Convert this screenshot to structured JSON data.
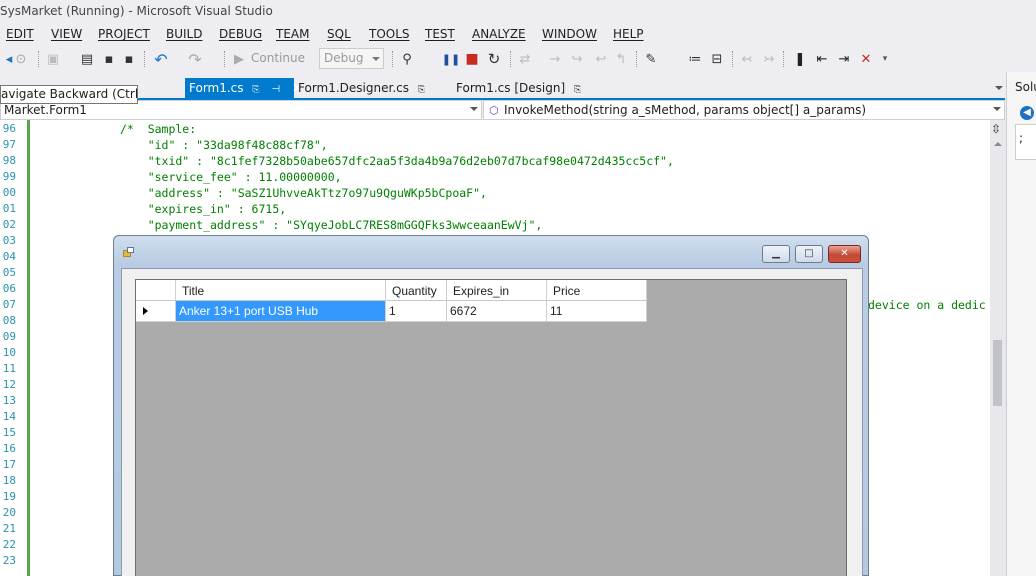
{
  "window": {
    "title": "SysMarket (Running) - Microsoft Visual Studio"
  },
  "menu": [
    "EDIT",
    "VIEW",
    "PROJECT",
    "BUILD",
    "DEBUG",
    "TEAM",
    "SQL",
    "TOOLS",
    "TEST",
    "ANALYZE",
    "WINDOW",
    "HELP"
  ],
  "toolbar": {
    "continue_label": "Continue",
    "config_value": "Debug"
  },
  "tooltip": "avigate Backward (Ctrl+-)",
  "tabs": [
    "Form1.cs",
    "Form1.Designer.cs",
    "Form1.cs [Design]"
  ],
  "nav": {
    "left": "Market.Form1",
    "right": "InvokeMethod(string a_sMethod, params object[] a_params)"
  },
  "editor": {
    "line_numbers": [
      "96",
      "97",
      "98",
      "99",
      "00",
      "01",
      "02",
      "03",
      "04",
      "05",
      "06",
      "07",
      "08",
      "09",
      "10",
      "11",
      "12",
      "13",
      "14",
      "15",
      "16",
      "17",
      "18",
      "19",
      "20",
      "21",
      "22",
      "23"
    ],
    "code": [
      "/*  Sample:",
      "    \"id\" : \"33da98f48c88cf78\",",
      "    \"txid\" : \"8c1fef7328b50abe657dfc2aa5f3da4b9a76d2eb07d7bcaf98e0472d435cc5cf\",",
      "    \"service_fee\" : 11.00000000,",
      "    \"address\" : \"SaSZ1UhvveAkTtz7o97u9QguWKp5bCpoaF\",",
      "    \"expires_in\" : 6715,",
      "    \"payment_address\" : \"SYqyeJobLC7RES8mGGQFks3wwceaanEwVj\","
    ],
    "code_right": "device on a dedic"
  },
  "solution_panel": {
    "label": "Solu",
    "box_text": ";"
  },
  "form": {
    "min_label": "▁",
    "max_label": "□",
    "close_label": "✕",
    "columns": [
      "Title",
      "Quantity",
      "Expires_in",
      "Price"
    ],
    "rows": [
      {
        "title": "Anker 13+1 port USB Hub",
        "quantity": "1",
        "expires_in": "6672",
        "price": "11"
      }
    ]
  }
}
